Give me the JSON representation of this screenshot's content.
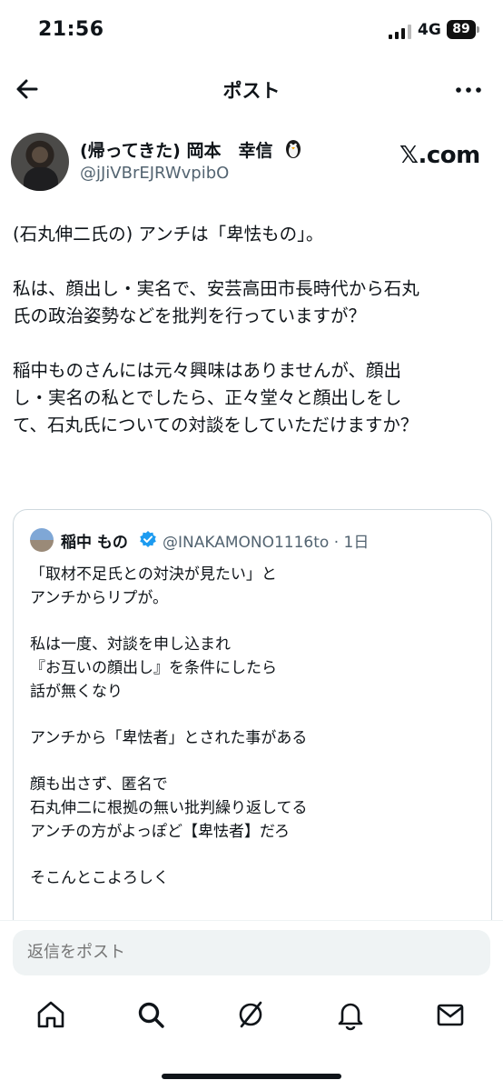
{
  "status_bar": {
    "time": "21:56",
    "network": "4G",
    "battery": "89"
  },
  "header": {
    "title": "ポスト",
    "back_icon": "arrow-left-icon",
    "more_icon": "more-icon"
  },
  "author": {
    "name": "(帰ってきた) 岡本　幸信",
    "handle": "@jJiVBrEJRWvpibO",
    "emoji_icon": "penguin-icon",
    "watermark": "𝕏.com"
  },
  "post": {
    "paragraphs": [
      "(石丸伸二氏の) アンチは「卑怯もの」。",
      "私は、顔出し・実名で、安芸高田市長時代から石丸\n氏の政治姿勢などを批判を行っていますが？",
      "稲中ものさんには元々興味はありませんが、顔出\nし・実名の私とでしたら、正々堂々と顔出しをし\nて、石丸氏についての対談をしていただけますか？"
    ]
  },
  "quote": {
    "name": "稲中 もの",
    "handle": "@INAKAMONO1116to · 1日",
    "paragraphs": [
      "「取材不足氏との対決が見たい」と\nアンチからリプが。",
      "私は一度、対談を申し込まれ\n『お互いの顔出し』を条件にしたら\n話が無くなり",
      "アンチから「卑怯者」とされた事がある",
      "顔も出さず、匿名で\n石丸伸二に根拠の無い批判繰り返してる\nアンチの方がよっぽど【卑怯者】だろ",
      "そこんとこよろしく"
    ]
  },
  "reply": {
    "placeholder": "返信をポスト"
  },
  "tabs": [
    "home-icon",
    "search-icon",
    "grok-icon",
    "notifications-icon",
    "messages-icon"
  ],
  "colors": {
    "text": "#0f1419",
    "secondary": "#536471",
    "verified": "#1d9bf0",
    "input_bg": "#eff3f4"
  }
}
